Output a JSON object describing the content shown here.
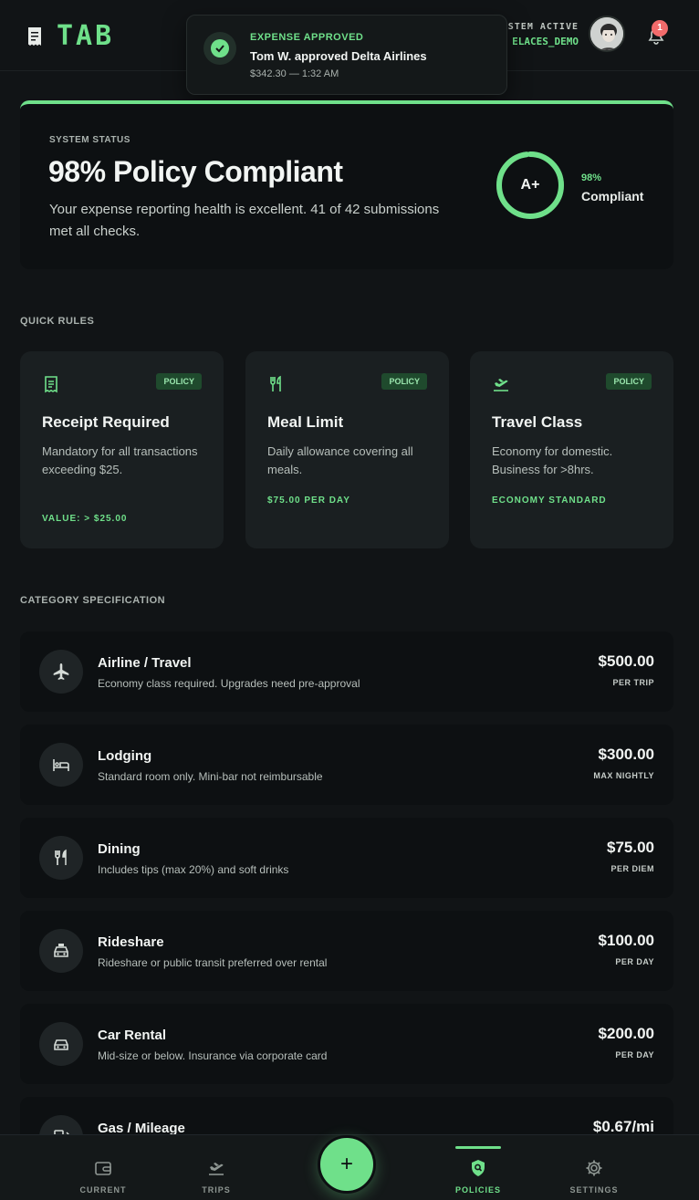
{
  "header": {
    "brand": "TAB",
    "system_label": "SYSTEM ACTIVE",
    "username": "ELACES_DEMO",
    "notification_count": "1"
  },
  "toast": {
    "title": "EXPENSE APPROVED",
    "message": "Tom W. approved Delta Airlines",
    "sub": "$342.30 — 1:32 AM"
  },
  "status": {
    "eyebrow": "SYSTEM STATUS",
    "title": "98% Policy Compliant",
    "description": "Your expense reporting health is excellent. 41 of 42 submissions met all checks.",
    "grade": "A+",
    "percent_label": "98%",
    "percent_value": 98,
    "compliance_label": "Compliant"
  },
  "quick_rules": {
    "label": "QUICK RULES",
    "cards": [
      {
        "badge": "POLICY",
        "title": "Receipt Required",
        "description": "Mandatory for all transactions exceeding $25.",
        "value": "VALUE: > $25.00",
        "icon": "receipt-icon"
      },
      {
        "badge": "POLICY",
        "title": "Meal Limit",
        "description": "Daily allowance covering all meals.",
        "value": "$75.00 PER DAY",
        "icon": "utensils-icon"
      },
      {
        "badge": "POLICY",
        "title": "Travel Class",
        "description": "Economy for domestic. Business for >8hrs.",
        "value": "ECONOMY STANDARD",
        "icon": "plane-departure-icon"
      }
    ]
  },
  "categories": {
    "label": "CATEGORY SPECIFICATION",
    "items": [
      {
        "name": "Airline / Travel",
        "description": "Economy class required. Upgrades need pre-approval",
        "amount": "$500.00",
        "unit": "PER TRIP",
        "icon": "plane-icon"
      },
      {
        "name": "Lodging",
        "description": "Standard room only. Mini-bar not reimbursable",
        "amount": "$300.00",
        "unit": "MAX NIGHTLY",
        "icon": "bed-icon"
      },
      {
        "name": "Dining",
        "description": "Includes tips (max 20%) and soft drinks",
        "amount": "$75.00",
        "unit": "PER DIEM",
        "icon": "utensils-icon"
      },
      {
        "name": "Rideshare",
        "description": "Rideshare or public transit preferred over rental",
        "amount": "$100.00",
        "unit": "PER DAY",
        "icon": "taxi-icon"
      },
      {
        "name": "Car Rental",
        "description": "Mid-size or below. Insurance via corporate card",
        "amount": "$200.00",
        "unit": "PER DAY",
        "icon": "car-icon"
      },
      {
        "name": "Gas / Mileage",
        "description": "",
        "amount": "$0.67/mi",
        "unit": "",
        "icon": "gas-pump-icon"
      }
    ]
  },
  "nav": {
    "items": [
      {
        "label": "CURRENT",
        "icon": "wallet-icon"
      },
      {
        "label": "TRIPS",
        "icon": "plane-departure-icon"
      },
      {
        "label": "POLICIES",
        "icon": "shield-search-icon"
      },
      {
        "label": "SETTINGS",
        "icon": "gear-icon"
      }
    ],
    "fab_label": "+"
  },
  "colors": {
    "accent": "#6fe08a",
    "background": "#111416",
    "card": "#1a1f21",
    "badge": "#f26b6b"
  }
}
